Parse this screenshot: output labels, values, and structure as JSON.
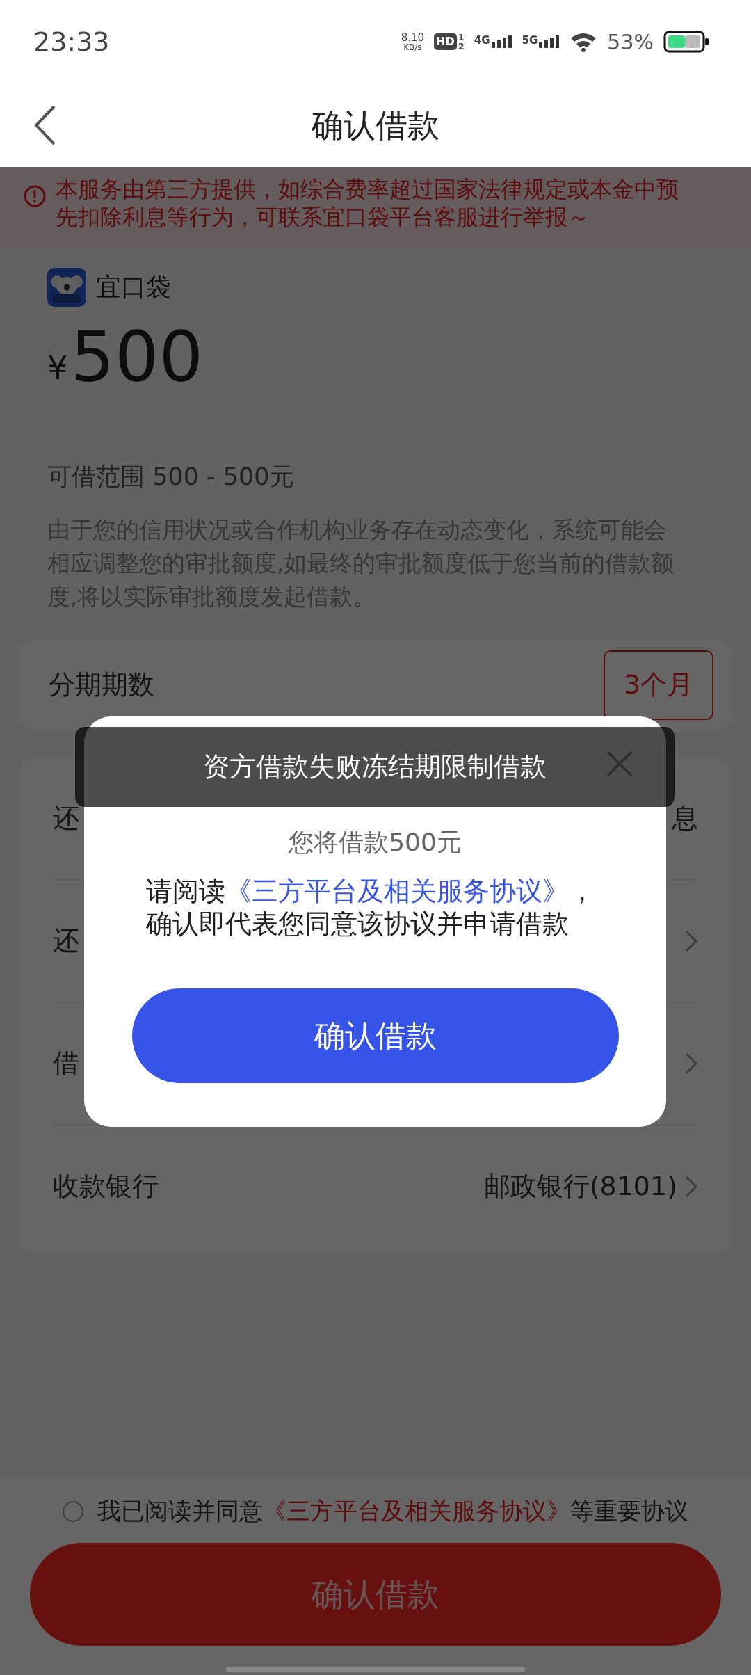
{
  "status_bar": {
    "time": "23:33",
    "speed_value": "8.10",
    "speed_unit": "KB/s",
    "hd": "HD",
    "hd_sims": [
      "1",
      "2"
    ],
    "networks": [
      "4G",
      "5G"
    ],
    "battery": "53%"
  },
  "header": {
    "title": "确认借款"
  },
  "notice": {
    "text": "本服务由第三方提供，如综合费率超过国家法律规定或本金中预先扣除利息等行为，可联系宜口袋平台客服进行举报～"
  },
  "lender": {
    "name": "宜口袋"
  },
  "amount": {
    "currency": "¥",
    "value": "500"
  },
  "range": "可借范围 500 - 500元",
  "disclaimer": "由于您的信用状况或合作机构业务存在动态变化，系统可能会相应调整您的审批额度,如最终的审批额度低于您当前的借款额度,将以实际审批额度发起借款。",
  "term": {
    "label": "分期期数",
    "value": "3个月"
  },
  "rows": [
    {
      "label": "还",
      "value": "息",
      "chevron": false
    },
    {
      "label": "还",
      "chevron": true
    },
    {
      "label": "借",
      "chevron": true
    },
    {
      "label": "收款银行",
      "value": "邮政银行(8101)",
      "chevron": true
    }
  ],
  "agreement": {
    "checked": false,
    "prefix": "我已阅读并同意",
    "link": "《三方平台及相关服务协议》",
    "suffix": "等重要协议"
  },
  "submit_button": "确认借款",
  "dialog": {
    "subtitle": "您将借款500元",
    "body_prefix": "请阅读",
    "body_link": "《三方平台及相关服务协议》",
    "body_suffix": "，确认即代表您同意该协议并申请借款",
    "button": "确认借款"
  },
  "toast": "资方借款失败冻结期限制借款"
}
